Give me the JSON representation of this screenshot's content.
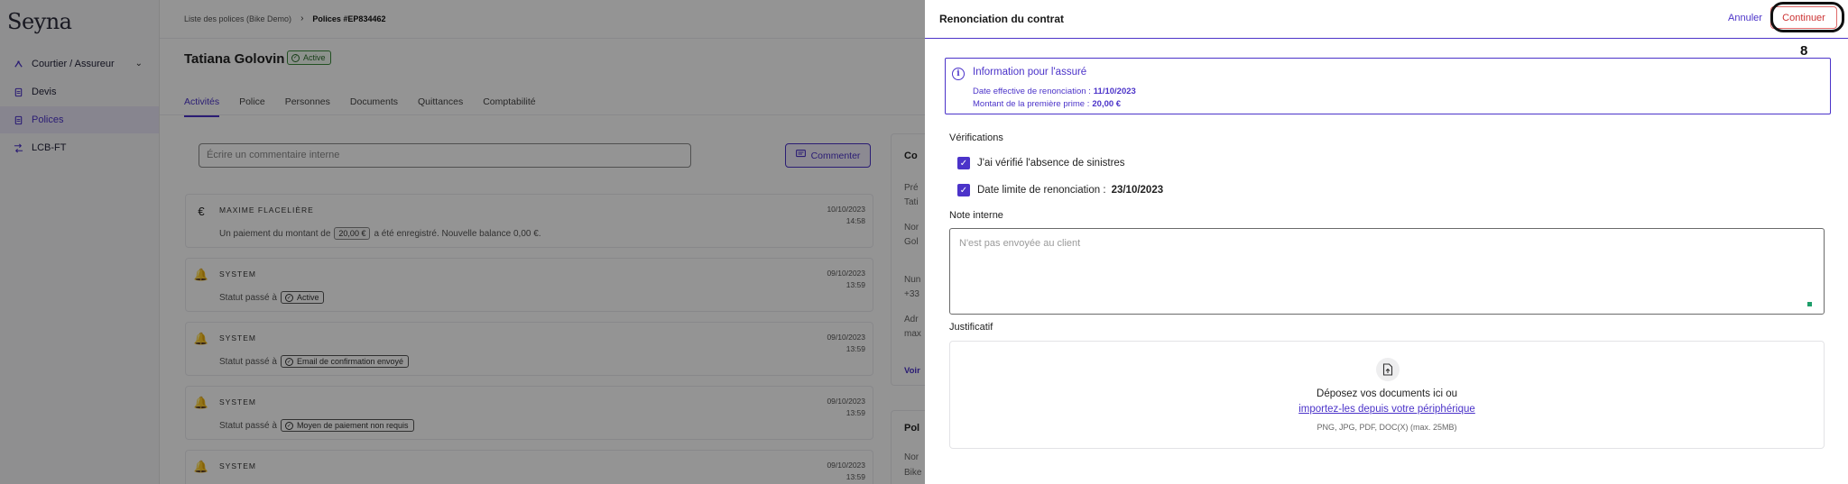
{
  "app": {
    "logo": "Seyna"
  },
  "sidebar": {
    "items": [
      {
        "label": "Courtier / Assureur",
        "icon": "user-switch-icon"
      },
      {
        "label": "Devis",
        "icon": "document-icon"
      },
      {
        "label": "Polices",
        "icon": "document-icon",
        "active": true
      },
      {
        "label": "LCB-FT",
        "icon": "shuffle-icon"
      }
    ]
  },
  "breadcrumb": {
    "parent": "Liste des polices (Bike Demo)",
    "current": "Polices #EP834462"
  },
  "header": {
    "name": "Tatiana Golovin",
    "status": "Active"
  },
  "tabs": [
    "Activités",
    "Police",
    "Personnes",
    "Documents",
    "Quittances",
    "Comptabilité"
  ],
  "comment": {
    "placeholder": "Écrire un commentaire interne",
    "button": "Commenter"
  },
  "activities": [
    {
      "who": "MAXIME FLACELIÈRE",
      "date": "10/10/2023",
      "time": "14:58",
      "icon": "euro-icon",
      "text_before": "Un paiement du montant de",
      "amount": "20,00 €",
      "text_after": "a été enregistré. Nouvelle balance 0,00 €."
    },
    {
      "who": "SYSTEM",
      "date": "09/10/2023",
      "time": "13:59",
      "icon": "bell-icon",
      "text_before": "Statut passé à",
      "status": "Active"
    },
    {
      "who": "SYSTEM",
      "date": "09/10/2023",
      "time": "13:59",
      "icon": "bell-icon",
      "text_before": "Statut passé à",
      "status": "Email de confirmation envoyé"
    },
    {
      "who": "SYSTEM",
      "date": "09/10/2023",
      "time": "13:59",
      "icon": "bell-icon",
      "text_before": "Statut passé à",
      "status": "Moyen de paiement non requis"
    },
    {
      "who": "SYSTEM",
      "date": "09/10/2023",
      "time": "13:59",
      "icon": "bell-icon"
    }
  ],
  "right_card": {
    "title": "Co",
    "lines": [
      "Pré",
      "Tati",
      "Nor",
      "Gol",
      "Nun",
      "+33",
      "Adr",
      "max"
    ],
    "link": "Voir"
  },
  "right_card2": {
    "title": "Pol",
    "lines": [
      "Nor",
      "Bike"
    ]
  },
  "drawer": {
    "title": "Renonciation du contrat",
    "cancel": "Annuler",
    "continue": "Continuer",
    "step": "8",
    "info": {
      "heading": "Information pour l'assuré",
      "row1_label": "Date effective de renonciation :",
      "row1_value": "11/10/2023",
      "row2_label": "Montant de la première prime :",
      "row2_value": "20,00 €"
    },
    "verifications": {
      "title": "Vérifications",
      "check1": "J'ai vérifié l'absence de sinistres",
      "check2_label": "Date limite de renonciation :",
      "check2_value": "23/10/2023"
    },
    "note": {
      "title": "Note interne",
      "placeholder": "N'est pas envoyée au client"
    },
    "upload": {
      "title": "Justificatif",
      "text": "Déposez vos documents ici ou",
      "link": "importez-les depuis votre périphérique",
      "hint": "PNG, JPG, PDF, DOC(X) (max. 25MB)"
    }
  }
}
